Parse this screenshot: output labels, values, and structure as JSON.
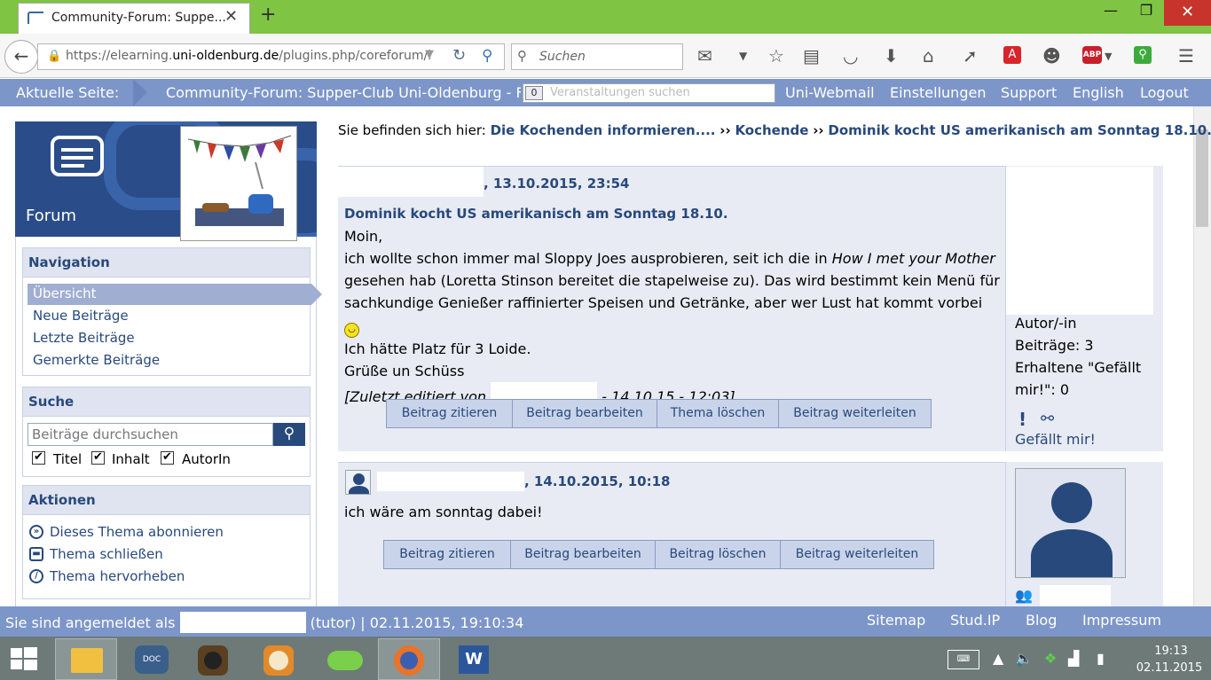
{
  "browser": {
    "tab_title": "Community-Forum: Suppe...",
    "url_plain": "https://elearning.",
    "url_domain": "uni-oldenburg.de",
    "url_rest": "/plugins.php/coreforum/i",
    "search_placeholder": "Suchen"
  },
  "header": {
    "current_label": "Aktuelle Seite:",
    "current_page": "Community-Forum: Supper-Club Uni-Oldenburg - Forum",
    "quicksearch_badge": "0",
    "quicksearch_placeholder": "Veranstaltungen suchen",
    "links": [
      "Uni-Webmail",
      "Einstellungen",
      "Support",
      "English",
      "Logout"
    ]
  },
  "sidebar": {
    "forum_label": "Forum",
    "navigation_title": "Navigation",
    "nav_items": [
      "Übersicht",
      "Neue Beiträge",
      "Letzte Beiträge",
      "Gemerkte Beiträge"
    ],
    "search_title": "Suche",
    "search_placeholder": "Beiträge durchsuchen",
    "search_options": [
      {
        "label": "Titel",
        "checked": true
      },
      {
        "label": "Inhalt",
        "checked": true
      },
      {
        "label": "AutorIn",
        "checked": true
      }
    ],
    "actions_title": "Aktionen",
    "actions": [
      "Dieses Thema abonnieren",
      "Thema schließen",
      "Thema hervorheben"
    ]
  },
  "breadcrumb": {
    "prefix": "Sie befinden sich hier:",
    "items": [
      "Die Kochenden informieren....",
      "Kochende",
      "Dominik kocht US amerikanisch am Sonntag 18.10."
    ],
    "separator": "››"
  },
  "posts": [
    {
      "meta": ", 13.10.2015, 23:54",
      "title": "Dominik kocht US amerikanisch am Sonntag 18.10.",
      "lines": [
        "Moin,",
        "ich wollte schon immer mal Sloppy Joes ausprobieren, seit ich die in ",
        "How I met your Mother",
        "gesehen hab (Loretta Stinson bereitet die stapelweise zu). Das wird bestimmt kein Menü für",
        "sachkundige Genießer raffinierter Speisen und Getränke, aber wer Lust hat kommt vorbei",
        "Ich hätte Platz für 3 Loide.",
        "Grüße un Schüss"
      ],
      "edited_prefix": "[Zuletzt editiert von",
      "edited_suffix": "- 14.10.15 - 12:03]",
      "buttons": [
        "Beitrag zitieren",
        "Beitrag bearbeiten",
        "Thema löschen",
        "Beitrag weiterleiten"
      ],
      "author_role": "Autor/-in",
      "author_posts": "Beiträge: 3",
      "author_likes_1": "Erhaltene \"Gefällt",
      "author_likes_2": "mir!\": 0",
      "like_label": "Gefällt mir!"
    },
    {
      "meta": ", 14.10.2015, 10:18",
      "text": "ich wäre am sonntag dabei!",
      "buttons": [
        "Beitrag zitieren",
        "Beitrag bearbeiten",
        "Beitrag löschen",
        "Beitrag weiterleiten"
      ]
    }
  ],
  "footer": {
    "logged_in_prefix": "Sie sind angemeldet als",
    "logged_in_suffix": "(tutor) | 02.11.2015, 19:10:34",
    "links": [
      "Sitemap",
      "Stud.IP",
      "Blog",
      "Impressum"
    ]
  },
  "taskbar": {
    "time": "19:13",
    "date": "02.11.2015"
  },
  "colors": {
    "brand": "#28497c",
    "header_bar": "#7d96c9",
    "tab_strip": "#7fc443"
  }
}
